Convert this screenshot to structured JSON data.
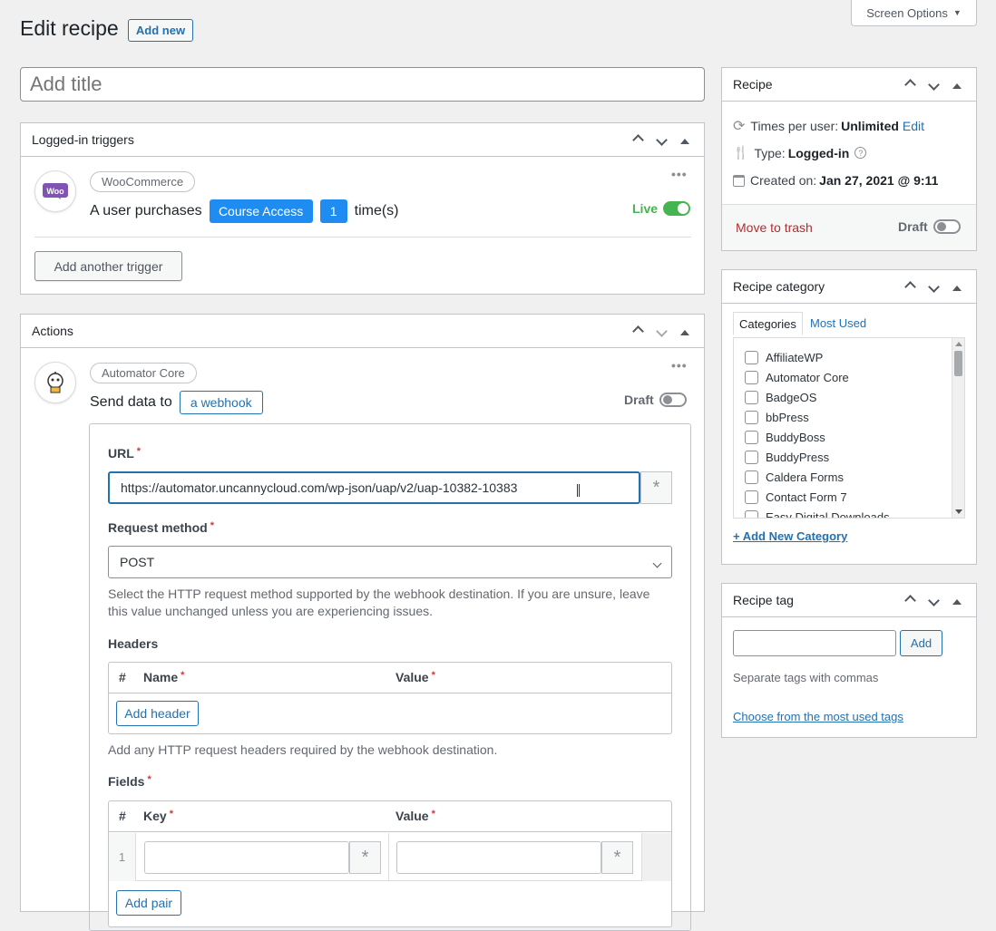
{
  "header": {
    "title": "Edit recipe",
    "add_new": "Add new",
    "screen_options": "Screen Options"
  },
  "title_input": {
    "placeholder": "Add title"
  },
  "triggers": {
    "heading": "Logged-in triggers",
    "integration": "WooCommerce",
    "sentence_start": "A user purchases",
    "token": "Course Access",
    "count": "1",
    "sentence_end": "time(s)",
    "status": "Live",
    "add_button": "Add another trigger",
    "icon": "woo-logo-icon"
  },
  "actions": {
    "heading": "Actions",
    "integration": "Automator Core",
    "sentence_start": "Send data to",
    "token": "a webhook",
    "status": "Draft",
    "url_label": "URL",
    "url_value": "https://automator.uncannycloud.com/wp-json/uap/v2/uap-10382-10383",
    "method_label": "Request method",
    "method_value": "POST",
    "method_help": "Select the HTTP request method supported by the webhook destination. If you are unsure, leave this value unchanged unless you are experiencing issues.",
    "headers_label": "Headers",
    "headers_cols": [
      "#",
      "Name",
      "Value"
    ],
    "add_header": "Add header",
    "headers_help": "Add any HTTP request headers required by the webhook destination.",
    "fields_label": "Fields",
    "fields_cols": [
      "#",
      "Key",
      "Value"
    ],
    "fields_row_num": "1",
    "add_pair": "Add pair"
  },
  "recipe_box": {
    "heading": "Recipe",
    "times_label": "Times per user:",
    "times_value": "Unlimited",
    "times_edit": "Edit",
    "type_label": "Type:",
    "type_value": "Logged-in",
    "created_label": "Created on:",
    "created_value": "Jan 27, 2021 @ 9:11",
    "trash": "Move to trash",
    "status": "Draft"
  },
  "category_box": {
    "heading": "Recipe category",
    "tabs": [
      "Categories",
      "Most Used"
    ],
    "items": [
      "AffiliateWP",
      "Automator Core",
      "BadgeOS",
      "bbPress",
      "BuddyBoss",
      "BuddyPress",
      "Caldera Forms",
      "Contact Form 7",
      "Easy Digital Downloads"
    ],
    "add_new": "+ Add New Category"
  },
  "tag_box": {
    "heading": "Recipe tag",
    "add": "Add",
    "help": "Separate tags with commas",
    "choose": "Choose from the most used tags"
  },
  "colors": {
    "accent": "#2271b1",
    "token_blue": "#1e8cf0",
    "live_green": "#46b450",
    "danger": "#b32d2e"
  }
}
